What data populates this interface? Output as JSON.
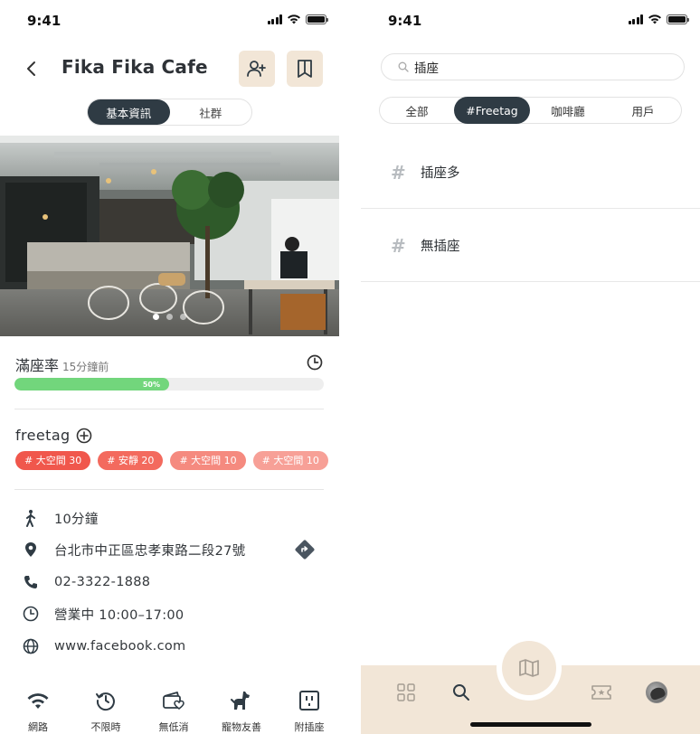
{
  "status_bar": {
    "time": "9:41"
  },
  "left": {
    "title": "Fika Fika Cafe",
    "segments": [
      {
        "label": "基本資訊",
        "active": true
      },
      {
        "label": "社群",
        "active": false
      }
    ],
    "carousel": {
      "pages": 3,
      "current": 1
    },
    "occupancy": {
      "label": "滿座率",
      "updated": "15分鐘前",
      "percent": 50,
      "percent_label": "50%"
    },
    "freetag": {
      "label": "freetag",
      "tags": [
        {
          "text": "# 大空間 30",
          "color": "#f0574c"
        },
        {
          "text": "# 安靜 20",
          "color": "#f36a5e"
        },
        {
          "text": "# 大空間 10",
          "color": "#f58a7f"
        },
        {
          "text": "# 大空間 10",
          "color": "#f7a097"
        }
      ]
    },
    "info": {
      "walk": "10分鐘",
      "address": "台北市中正區忠孝東路二段27號",
      "phone": "02-3322-1888",
      "hours": "營業中 10:00–17:00",
      "website": "www.facebook.com"
    },
    "features": [
      {
        "icon": "wifi-icon",
        "label": "網路"
      },
      {
        "icon": "history-icon",
        "label": "不限時"
      },
      {
        "icon": "wallet-heart-icon",
        "label": "無低消"
      },
      {
        "icon": "dog-icon",
        "label": "寵物友善"
      },
      {
        "icon": "power-socket-icon",
        "label": "附插座"
      }
    ]
  },
  "right": {
    "search": {
      "value": "插座"
    },
    "filters": [
      {
        "label": "全部",
        "active": false
      },
      {
        "label": "#Freetag",
        "active": true
      },
      {
        "label": "咖啡廳",
        "active": false
      },
      {
        "label": "用戶",
        "active": false
      }
    ],
    "results": [
      {
        "hash": "#",
        "label": "插座多"
      },
      {
        "hash": "#",
        "label": "無插座"
      }
    ],
    "tabbar": [
      "grid-icon",
      "search-icon",
      "map-icon",
      "ticket-icon",
      "avatar"
    ]
  },
  "colors": {
    "accent_beige": "#f2e6d7",
    "dark": "#2f3b44",
    "progress": "#72d67c"
  }
}
